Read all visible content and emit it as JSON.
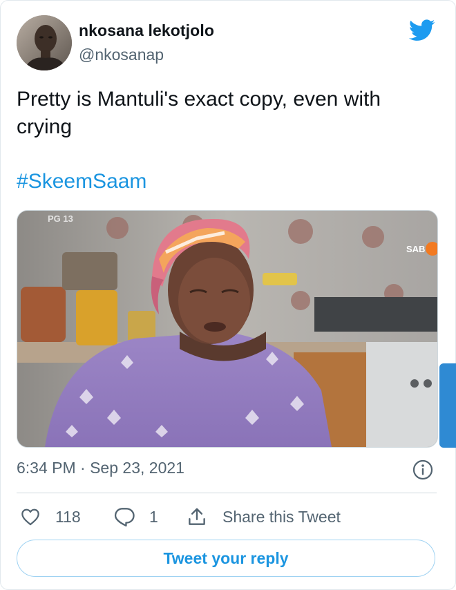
{
  "tweet": {
    "display_name": "nkosana lekotjolo",
    "handle": "@nkosanap",
    "text": "Pretty is Mantuli's exact copy, even with crying",
    "hashtag": "#SkeemSaam",
    "timestamp": "6:34 PM · Sep 23, 2021"
  },
  "media": {
    "rating_overlay": "PG 13",
    "channel_logo": "SABC"
  },
  "actions": {
    "like_count": "118",
    "reply_count": "1",
    "share_label": "Share this Tweet"
  },
  "reply_button": {
    "label": "Tweet your reply"
  },
  "icons": {
    "brand": "twitter-bird-icon",
    "info": "info-icon",
    "like": "heart-icon",
    "reply": "reply-bubble-icon",
    "share": "share-icon"
  },
  "colors": {
    "accent": "#1b95e0",
    "secondary_text": "#536471",
    "border": "#cfd9de"
  }
}
